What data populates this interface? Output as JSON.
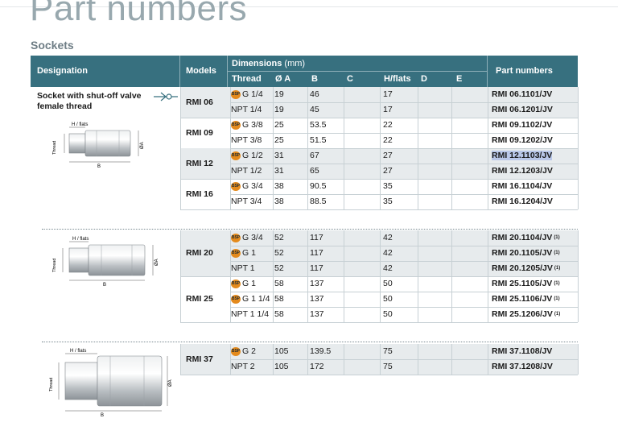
{
  "page": {
    "title": "Part numbers",
    "section": "Sockets"
  },
  "headers": {
    "designation": "Designation",
    "models": "Models",
    "dimensions": "Dimensions",
    "dimensions_unit": "(mm)",
    "thread": "Thread",
    "a": "Ø A",
    "b": "B",
    "c": "C",
    "hflats": "H/flats",
    "d": "D",
    "e": "E",
    "part_numbers": "Part numbers"
  },
  "designation": {
    "line1": "Socket with shut-off valve",
    "line2": "female thread"
  },
  "bsp_badge": "BSP",
  "note_mark": "(1)",
  "drawing_labels": {
    "hflats": "H / flats",
    "thread": "Thread",
    "b": "B",
    "a": "ØA"
  },
  "models": [
    "RMI 06",
    "RMI 09",
    "RMI 12",
    "RMI 16",
    "RMI 20",
    "RMI 25",
    "RMI 37"
  ],
  "rows": [
    {
      "thread": "G 1/4",
      "bsp": true,
      "a": "19",
      "b": "46",
      "c": "",
      "h": "17",
      "d": "",
      "e": "",
      "part": "RMI 06.1101/JV"
    },
    {
      "thread": "NPT 1/4",
      "bsp": false,
      "a": "19",
      "b": "45",
      "c": "",
      "h": "17",
      "d": "",
      "e": "",
      "part": "RMI 06.1201/JV"
    },
    {
      "thread": "G 3/8",
      "bsp": true,
      "a": "25",
      "b": "53.5",
      "c": "",
      "h": "22",
      "d": "",
      "e": "",
      "part": "RMI 09.1102/JV"
    },
    {
      "thread": "NPT 3/8",
      "bsp": false,
      "a": "25",
      "b": "51.5",
      "c": "",
      "h": "22",
      "d": "",
      "e": "",
      "part": "RMI 09.1202/JV"
    },
    {
      "thread": "G 1/2",
      "bsp": true,
      "a": "31",
      "b": "67",
      "c": "",
      "h": "27",
      "d": "",
      "e": "",
      "part": "RMI 12.1103/JV"
    },
    {
      "thread": "NPT 1/2",
      "bsp": false,
      "a": "31",
      "b": "65",
      "c": "",
      "h": "27",
      "d": "",
      "e": "",
      "part": "RMI 12.1203/JV"
    },
    {
      "thread": "G 3/4",
      "bsp": true,
      "a": "38",
      "b": "90.5",
      "c": "",
      "h": "35",
      "d": "",
      "e": "",
      "part": "RMI 16.1104/JV"
    },
    {
      "thread": "NPT 3/4",
      "bsp": false,
      "a": "38",
      "b": "88.5",
      "c": "",
      "h": "35",
      "d": "",
      "e": "",
      "part": "RMI 16.1204/JV"
    },
    {
      "thread": "G 3/4",
      "bsp": true,
      "a": "52",
      "b": "117",
      "c": "",
      "h": "42",
      "d": "",
      "e": "",
      "part": "RMI 20.1104/JV"
    },
    {
      "thread": "G 1",
      "bsp": true,
      "a": "52",
      "b": "117",
      "c": "",
      "h": "42",
      "d": "",
      "e": "",
      "part": "RMI 20.1105/JV"
    },
    {
      "thread": "NPT 1",
      "bsp": false,
      "a": "52",
      "b": "117",
      "c": "",
      "h": "42",
      "d": "",
      "e": "",
      "part": "RMI 20.1205/JV"
    },
    {
      "thread": "G 1",
      "bsp": true,
      "a": "58",
      "b": "137",
      "c": "",
      "h": "50",
      "d": "",
      "e": "",
      "part": "RMI 25.1105/JV"
    },
    {
      "thread": "G 1 1/4",
      "bsp": true,
      "a": "58",
      "b": "137",
      "c": "",
      "h": "50",
      "d": "",
      "e": "",
      "part": "RMI 25.1106/JV"
    },
    {
      "thread": "NPT 1 1/4",
      "bsp": false,
      "a": "58",
      "b": "137",
      "c": "",
      "h": "50",
      "d": "",
      "e": "",
      "part": "RMI 25.1206/JV"
    },
    {
      "thread": "G 2",
      "bsp": true,
      "a": "105",
      "b": "139.5",
      "c": "",
      "h": "75",
      "d": "",
      "e": "",
      "part": "RMI 37.1108/JV"
    },
    {
      "thread": "NPT 2",
      "bsp": false,
      "a": "105",
      "b": "172",
      "c": "",
      "h": "75",
      "d": "",
      "e": "",
      "part": "RMI 37.1208/JV"
    }
  ],
  "colors": {
    "header": "#37707f",
    "title": "#98a8ae",
    "section": "#6e7d85",
    "shade": "#e7ebed",
    "bsp": "#e48a1c"
  }
}
